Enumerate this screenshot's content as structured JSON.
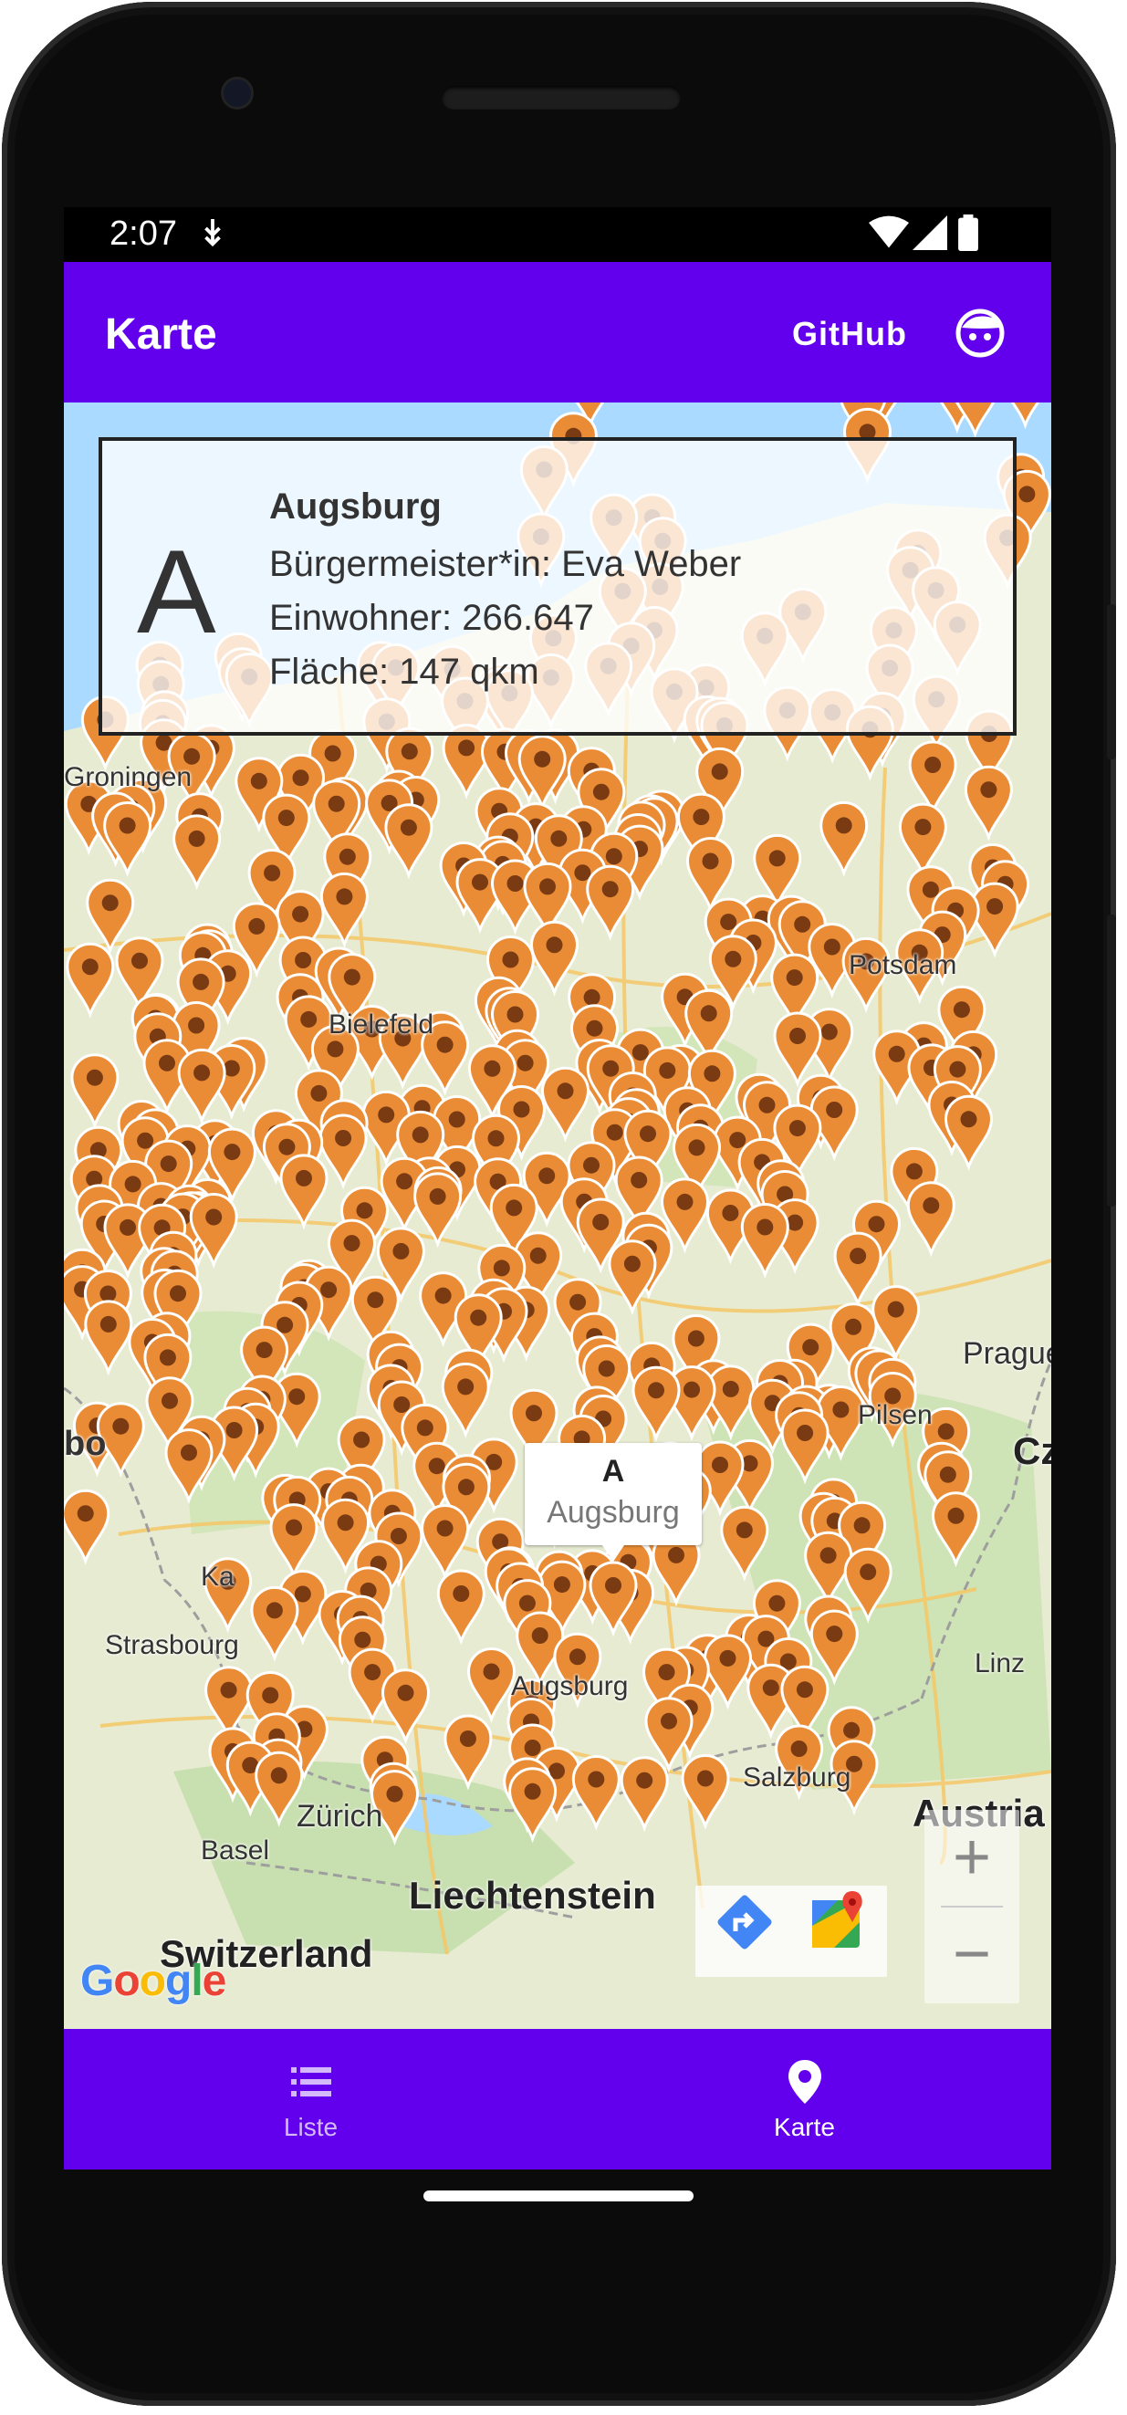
{
  "status_bar": {
    "time": "2:07"
  },
  "app_bar": {
    "title": "Karte",
    "action_label": "GitHub"
  },
  "info_card": {
    "letter": "A",
    "name": "Augsburg",
    "mayor_line": "Bürgermeister*in: Eva Weber",
    "population_line": "Einwohner: 266.647",
    "area_line": "Fläche: 147 qkm"
  },
  "marker_callout": {
    "letter": "A",
    "name": "Augsburg"
  },
  "map_labels": {
    "groningen": "Groningen",
    "bielefeld": "Bielefeld",
    "potsdam": "Potsdam",
    "prague": "Prague",
    "pilsen": "Pilsen",
    "czechia": "Cz",
    "strasbourg": "Strasbourg",
    "augsburg": "Augsburg",
    "linz": "Linz",
    "salzburg": "Salzburg",
    "austria": "Austria",
    "basel": "Basel",
    "zurich": "Zürich",
    "liechtenstein": "Liechtenstein",
    "switzerland": "Switzerland",
    "karlsruhe": "Ka",
    "luxembourg": "bo"
  },
  "map_controls": {
    "zoom_in": "+",
    "zoom_out": "−"
  },
  "google_logo": "Google",
  "bottom_nav": [
    {
      "label": "Liste",
      "icon": "list-icon",
      "active": false
    },
    {
      "label": "Karte",
      "icon": "map-pin-icon",
      "active": true
    }
  ],
  "colors": {
    "primary": "#6200ee",
    "marker": "#e98c35",
    "marker_dot": "#7a3a12",
    "map_land": "#e7ebd2",
    "water": "#aadaff"
  }
}
